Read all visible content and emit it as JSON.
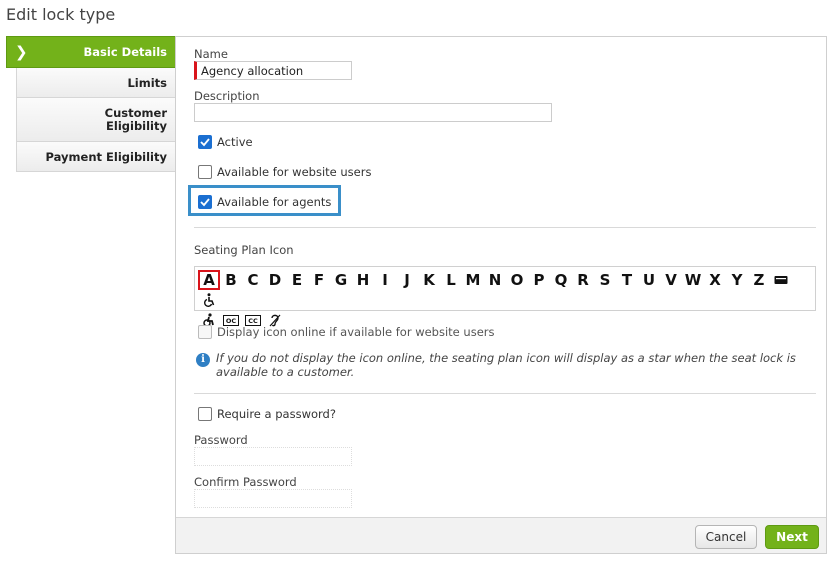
{
  "page": {
    "title": "Edit lock type"
  },
  "sidebar": {
    "items": [
      {
        "label": "Basic Details",
        "active": true
      },
      {
        "label": "Limits",
        "active": false
      },
      {
        "label": "Customer Eligibility",
        "active": false
      },
      {
        "label": "Payment Eligibility",
        "active": false
      }
    ]
  },
  "form": {
    "name": {
      "label": "Name",
      "value": "Agency allocation"
    },
    "description": {
      "label": "Description",
      "value": ""
    },
    "active": {
      "label": "Active",
      "checked": true
    },
    "website_users": {
      "label": "Available for website users",
      "checked": false
    },
    "agents": {
      "label": "Available for agents",
      "checked": true
    },
    "seating_plan": {
      "label": "Seating Plan Icon",
      "letters": [
        "A",
        "B",
        "C",
        "D",
        "E",
        "F",
        "G",
        "H",
        "I",
        "J",
        "K",
        "L",
        "M",
        "N",
        "O",
        "P",
        "Q",
        "R",
        "S",
        "T",
        "U",
        "V",
        "W",
        "X",
        "Y",
        "Z"
      ],
      "selected": "A",
      "symbols": [
        "ticket-icon",
        "wheelchair-icon",
        "wheelchair-active-icon",
        "oc-open-caption-icon",
        "cc-closed-caption-icon",
        "hearing-assist-icon"
      ],
      "display_online": {
        "label": "Display icon online if available for website users",
        "checked": false
      },
      "info": "If you do not display the icon online, the seating plan icon will display as a star when the seat lock is available to a customer."
    },
    "require_password": {
      "label": "Require a password?",
      "checked": false
    },
    "password": {
      "label": "Password",
      "value": ""
    },
    "confirm_password": {
      "label": "Confirm Password",
      "value": ""
    }
  },
  "footer": {
    "cancel_label": "Cancel",
    "next_label": "Next"
  },
  "colors": {
    "accent_green": "#73b21a",
    "highlight_blue": "#3a8fc9",
    "required_red": "#d9141b",
    "checkbox_blue": "#1b6fd1"
  }
}
